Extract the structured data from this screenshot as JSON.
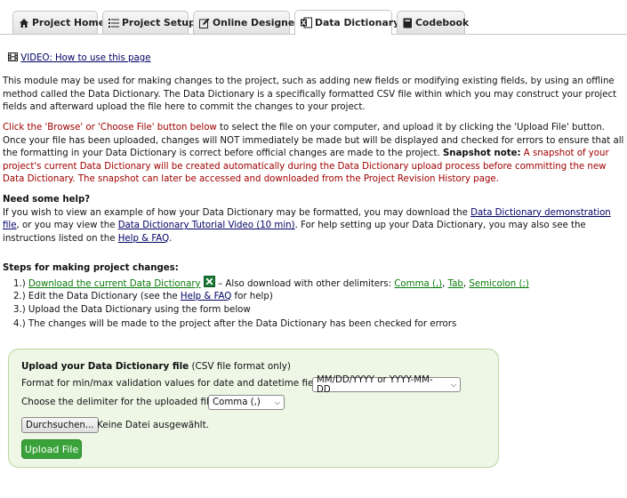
{
  "tabs": [
    {
      "icon": "home-icon",
      "label": "Project Home"
    },
    {
      "icon": "list-icon",
      "label": "Project Setup"
    },
    {
      "icon": "edit-icon",
      "label": "Online Designer"
    },
    {
      "icon": "excel-icon",
      "label": "Data Dictionary"
    },
    {
      "icon": "book-icon",
      "label": "Codebook"
    }
  ],
  "video_link": "VIDEO: How to use this page",
  "intro": "This module may be used for making changes to the project, such as adding new fields or modifying existing fields, by using an offline method called the Data Dictionary. The Data Dictionary is a specifically formatted CSV file within which you may construct your project fields and afterward upload the file here to commit the changes to your project.",
  "instructions": {
    "part1": "Click the 'Browse' or 'Choose File' button below",
    "part2": " to select the file on your computer, and upload it by clicking the 'Upload File' button. Once your file has been uploaded, changes will NOT immediately be made but will be displayed and checked for errors to ensure that all the formatting in your Data Dictionary is correct before official changes are made to the project. ",
    "snapshot_label": "Snapshot note:",
    "part3": " A snapshot of your project's current Data Dictionary will be created automatically during the Data Dictionary upload process before committing the new Data Dictionary. The snapshot can later be accessed and downloaded from the Project Revision History page."
  },
  "help": {
    "heading": "Need some help?",
    "t1": "If you wish to view an example of how your Data Dictionary may be formatted, you may download the ",
    "link1": "Data Dictionary demonstration file",
    "t2": ", or you may view the ",
    "link2": "Data Dictionary Tutorial Video (10 min)",
    "t3": ". For help setting up your Data Dictionary, you may also see the instructions listed on the ",
    "link3": "Help & FAQ",
    "t4": "."
  },
  "steps": {
    "heading": "Steps for making project changes:",
    "s1_prefix": "1.) ",
    "s1_link": "Download the current Data Dictionary",
    "s1_mid": " – Also download with other delimiters: ",
    "delim_comma": "Comma (,)",
    "sep1": ", ",
    "delim_tab": "Tab",
    "sep2": ", ",
    "delim_semicolon": "Semicolon (;)",
    "s2_prefix": "2.) Edit the Data Dictionary (see the ",
    "s2_link": "Help & FAQ",
    "s2_suffix": " for help)",
    "s3": "3.) Upload the Data Dictionary using the form below",
    "s4": "4.) The changes will be made to the project after the Data Dictionary has been checked for errors"
  },
  "upload": {
    "title": "Upload your Data Dictionary file",
    "title_note": " (CSV file format only)",
    "date_label": "Format for min/max validation values for date and datetime fields:",
    "date_value": "MM/DD/YYYY or YYYY-MM-DD",
    "delim_label": "Choose the delimiter for the uploaded file:",
    "delim_value": "Comma (,)",
    "browse_label": "Durchsuchen...",
    "no_file": "Keine Datei ausgewählt.",
    "button": "Upload File"
  }
}
